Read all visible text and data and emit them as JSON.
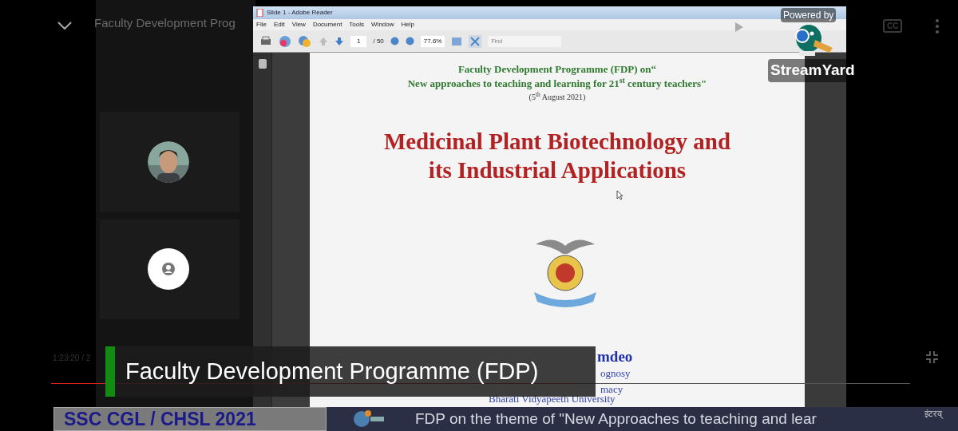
{
  "player": {
    "title": "Faculty Development Prog",
    "captions_button": "CC",
    "time": "1:23:20 / 2",
    "progress": {
      "level": 0.61
    }
  },
  "participants": [
    {
      "kind": "picture"
    },
    {
      "kind": "generic"
    }
  ],
  "reader": {
    "title": "Slide 1 - Adobe Reader",
    "menu": [
      "File",
      "Edit",
      "View",
      "Document",
      "Tools",
      "Window",
      "Help"
    ],
    "page": "1",
    "page_count": "/ 50",
    "zoom": "77.6%",
    "find_placeholder": "Find"
  },
  "slide": {
    "heading_lines": [
      "Faculty Development Programme (FDP) on“",
      "New approaches to teaching and learning for 21$^{st}$ century teachers\""
    ],
    "date": "(5$^{th}$ August 2021)",
    "title_lines": [
      "Medicinal Plant Biotechnology and",
      "its Industrial Applications"
    ],
    "author": "mdeo",
    "author_lines": [
      "ognosy",
      "macy"
    ],
    "university": "Bharati Vidyapeeth University"
  },
  "branding": {
    "powered_by": "Powered by",
    "name": "StreamYard"
  },
  "lower_third": {
    "text": "Faculty Development Programme (FDP)"
  },
  "ticker": {
    "badge": "SSC CGL / CHSL 2021",
    "headline": "FDP on the theme of \"New Approaches to teaching and lear",
    "trailing": "इंटरव्"
  }
}
